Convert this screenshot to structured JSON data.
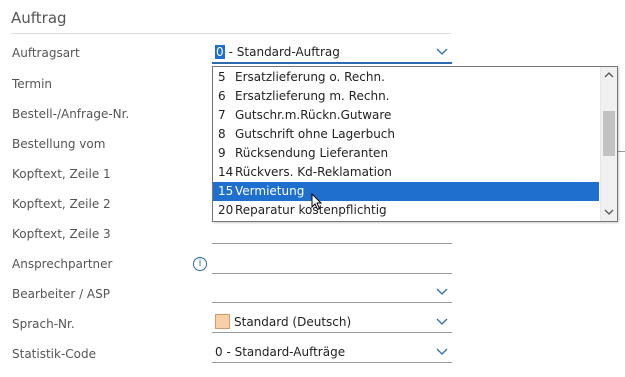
{
  "section": {
    "title": "Auftrag"
  },
  "labels": {
    "auftragsart": "Auftragsart",
    "termin": "Termin",
    "bestell_nr": "Bestell-/Anfrage-Nr.",
    "bestellung_vom": "Bestellung vom",
    "kopftext1": "Kopftext, Zeile 1",
    "kopftext2": "Kopftext, Zeile 2",
    "kopftext3": "Kopftext, Zeile 3",
    "ansprechpartner": "Ansprechpartner",
    "bearbeiter": "Bearbeiter / ASP",
    "sprach_nr": "Sprach-Nr.",
    "statistik_code": "Statistik-Code"
  },
  "fields": {
    "auftragsart": {
      "code": "0",
      "text": "- Standard-Auftrag"
    },
    "sprach_nr": {
      "text": "Standard (Deutsch)",
      "swatch_color": "#f7cfa9"
    },
    "statistik_code": {
      "text": "0  - Standard-Aufträge"
    }
  },
  "dropdown": {
    "items": [
      {
        "num": "5",
        "text": "Ersatzlieferung o. Rechn."
      },
      {
        "num": "6",
        "text": "Ersatzlieferung m. Rechn."
      },
      {
        "num": "7",
        "text": "Gutschr.m.Rückn.Gutware"
      },
      {
        "num": "8",
        "text": "Gutschrift ohne Lagerbuch"
      },
      {
        "num": "9",
        "text": "Rücksendung Lieferanten"
      },
      {
        "num": "14",
        "text": "Rückvers. Kd-Reklamation"
      },
      {
        "num": "15",
        "text": "Vermietung"
      },
      {
        "num": "20",
        "text": "Reparatur kostenpflichtig"
      }
    ],
    "selected_index": 6
  },
  "icons": {
    "info": "info-icon",
    "chevron": "chevron-down-icon",
    "cursor": "mouse-cursor-icon"
  },
  "colors": {
    "accent": "#1f6fcf"
  }
}
